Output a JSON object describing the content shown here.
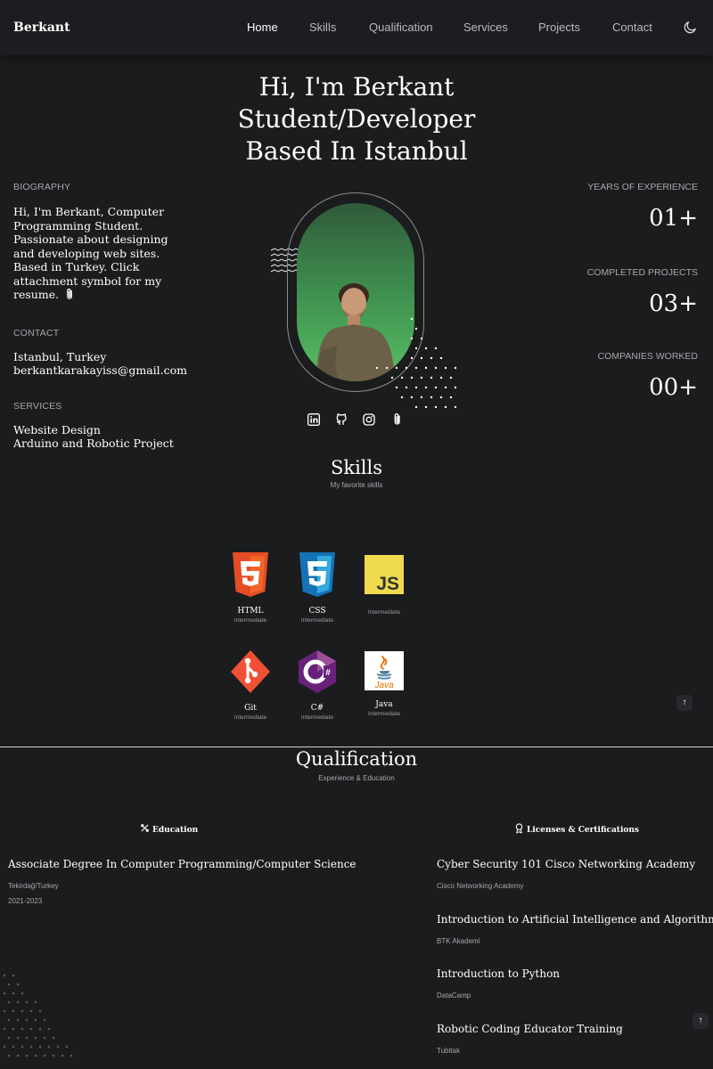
{
  "header": {
    "logo": "Berkant",
    "nav": [
      "Home",
      "Skills",
      "Qualification",
      "Services",
      "Projects",
      "Contact"
    ],
    "active": "Home",
    "theme_icon": "moon-icon"
  },
  "hero": {
    "title_lines": [
      "Hi, I'm Berkant",
      "Student/Developer",
      "Based In Istanbul"
    ],
    "biography_label": "BIOGRAPHY",
    "biography_text": "Hi, I'm Berkant, Computer Programming Student. Passionate about designing and developing web sites. Based in Turkey. Click attachment symbol for my resume.",
    "contact_label": "CONTACT",
    "contact_lines": [
      "Istanbul, Turkey",
      "berkantkarakayiss@gmail.com"
    ],
    "services_label": "SERVICES",
    "services_lines": [
      "Website Design",
      "Arduino and Robotic Project"
    ],
    "stats": [
      {
        "label": "YEARS OF EXPERIENCE",
        "value": "01+"
      },
      {
        "label": "COMPLETED PROJECTS",
        "value": "03+"
      },
      {
        "label": "COMPANIES WORKED",
        "value": "00+"
      }
    ],
    "social_icons": [
      "linkedin-icon",
      "github-icon",
      "instagram-icon",
      "paperclip-icon"
    ]
  },
  "skills": {
    "title": "Skills",
    "subtitle": "My favorite skills",
    "items": [
      {
        "name": "HTML",
        "level": "Intermediate",
        "icon": "html5-icon"
      },
      {
        "name": "CSS",
        "level": "Intermediate",
        "icon": "css3-icon"
      },
      {
        "name": "",
        "level": "Intermediate",
        "icon": "javascript-icon"
      },
      {
        "name": "Git",
        "level": "Intermediate",
        "icon": "git-icon"
      },
      {
        "name": "C#",
        "level": "Intermediate",
        "icon": "csharp-icon"
      },
      {
        "name": "Java",
        "level": "Intermediate",
        "icon": "java-icon"
      }
    ]
  },
  "qualification": {
    "title": "Qualification",
    "subtitle": "Experience & Education",
    "education_tab": "Education",
    "licenses_tab": "Licenses & Certifications",
    "education": [
      {
        "title": "Associate Degree In Computer Programming/Computer Science",
        "place": "Tekirdağ/Turkey",
        "date": "2021-2023"
      }
    ],
    "licenses": [
      {
        "title": "Cyber Security 101 Cisco Networking Academy",
        "issuer": "Cisco Networking Academy"
      },
      {
        "title": "Introduction to Artificial Intelligence and Algorithms",
        "issuer": "BTK Akademi"
      },
      {
        "title": "Introduction to Python",
        "issuer": "DataCamp"
      },
      {
        "title": "Robotic Coding Educator Training",
        "issuer": "Tubitak"
      }
    ]
  },
  "colors": {
    "background": "#1b1c1e",
    "accent_green": "#4caf50",
    "text_muted": "#a6a7aa"
  }
}
